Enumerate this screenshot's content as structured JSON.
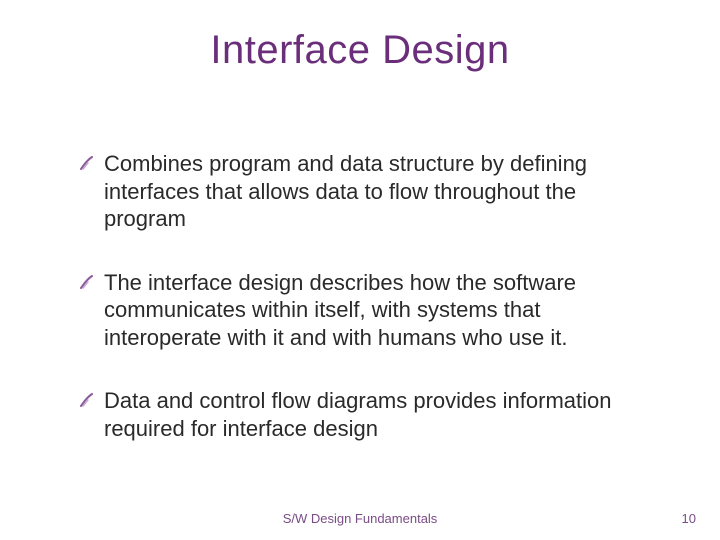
{
  "title": "Interface Design",
  "bullets": [
    "Combines program and data structure by defining interfaces that allows data to flow throughout the program",
    "The interface design describes how the software communicates within itself, with systems that interoperate with it and with humans who use it.",
    "Data and control flow diagrams provides information required for interface design"
  ],
  "footer": {
    "center": "S/W Design Fundamentals",
    "page": "10"
  }
}
